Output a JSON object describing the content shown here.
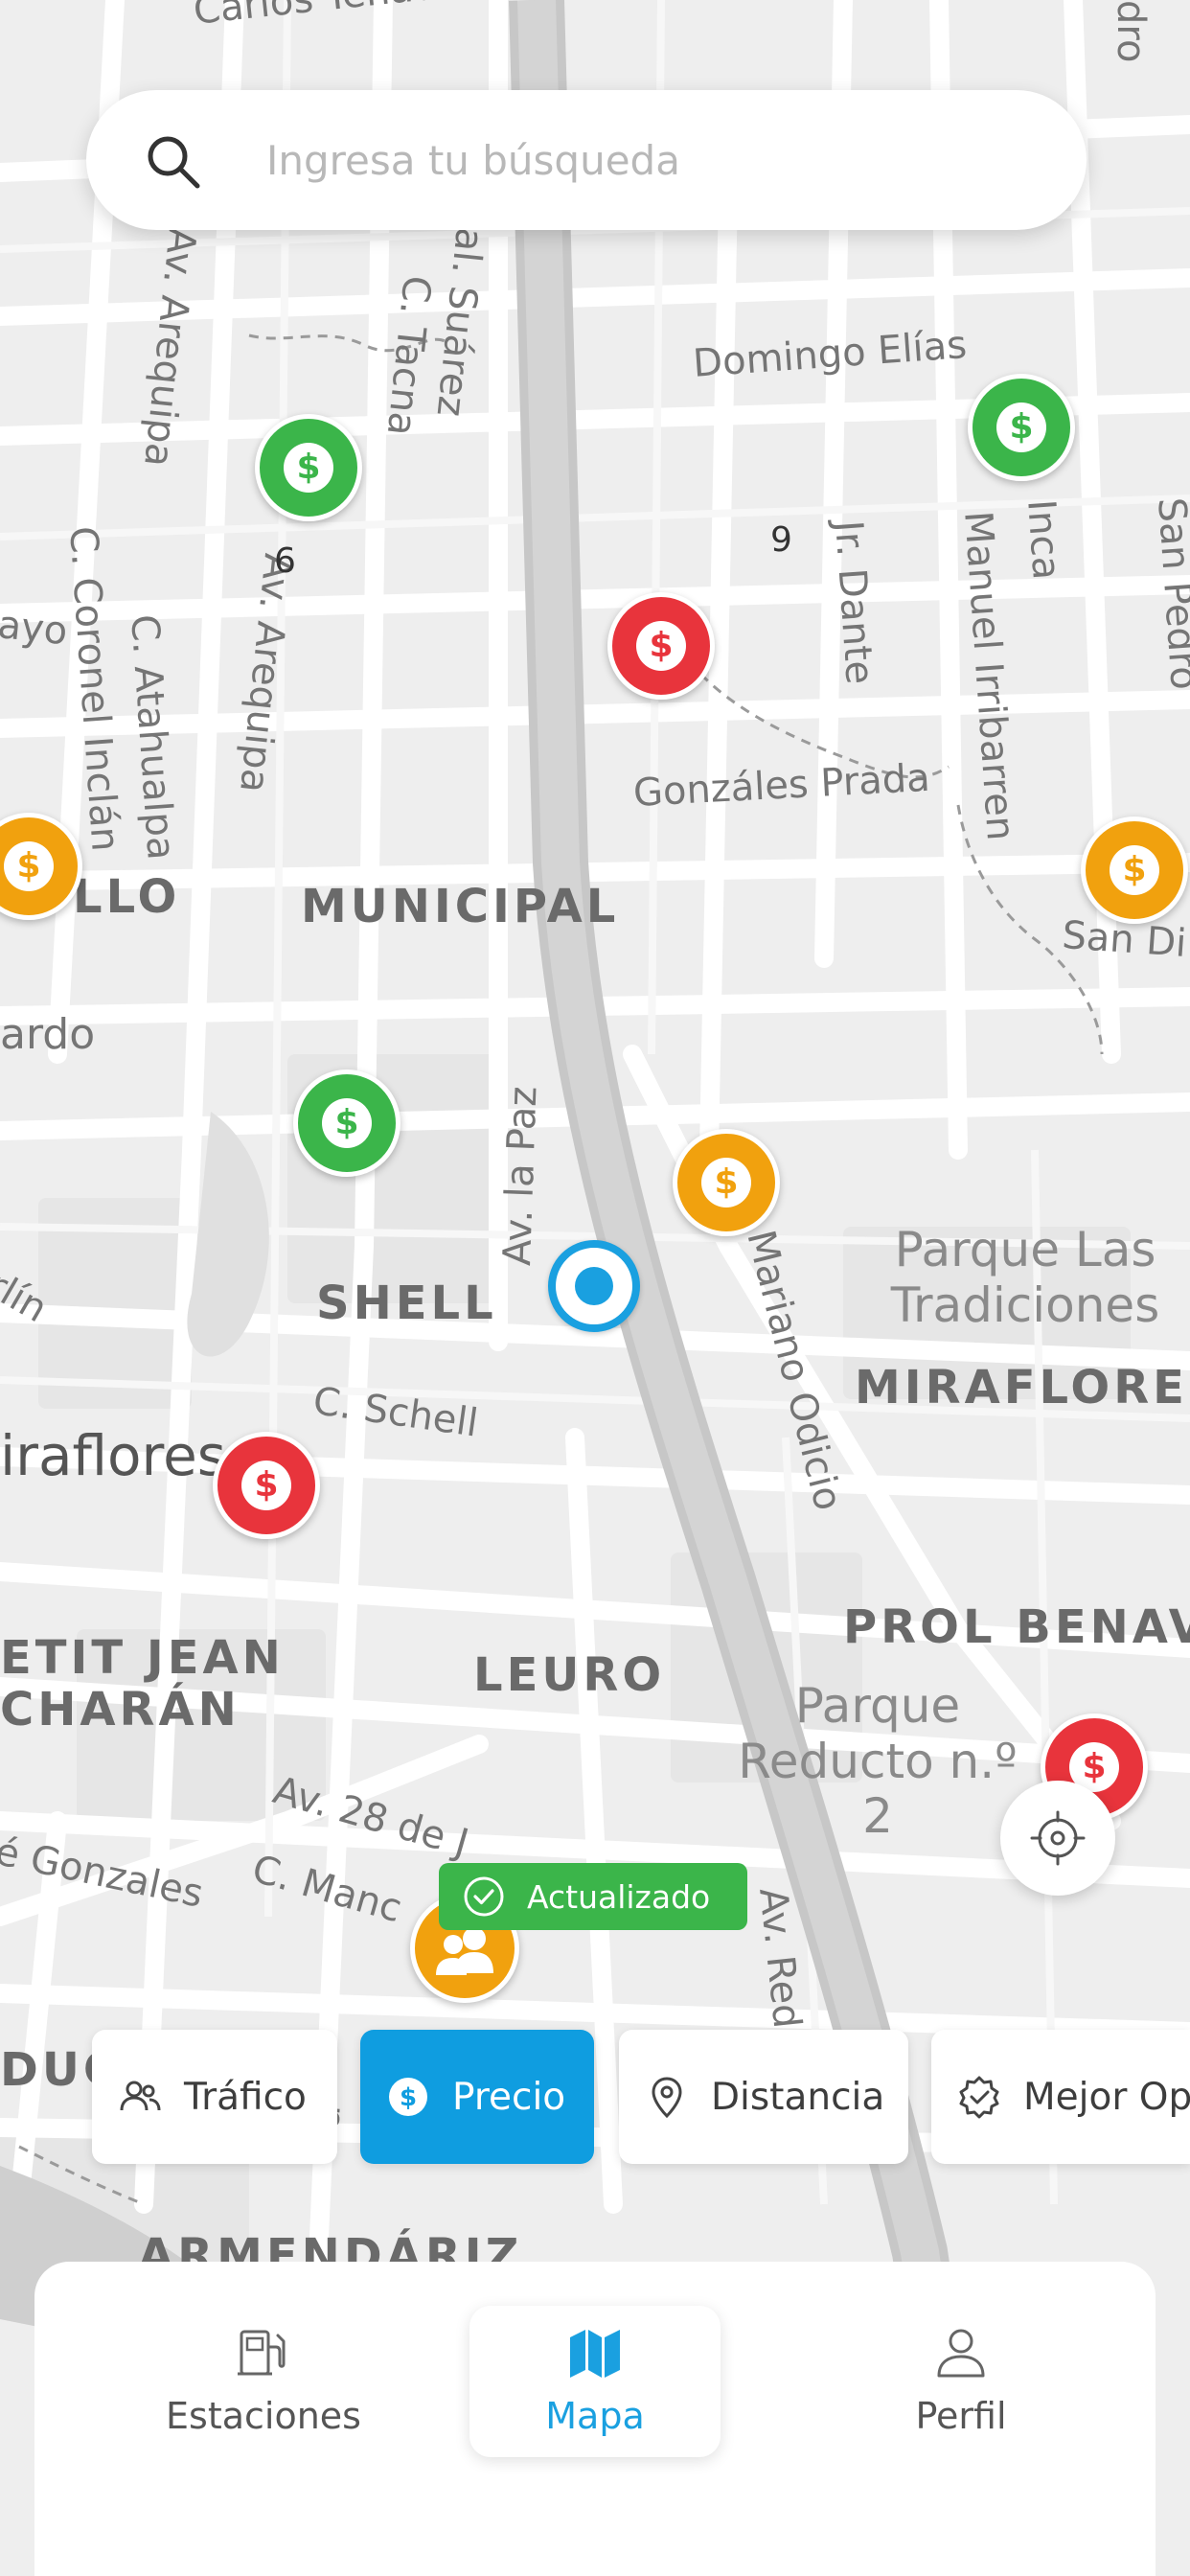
{
  "search": {
    "placeholder": "Ingresa tu búsqueda",
    "icon": "search-icon"
  },
  "map": {
    "street_labels": [
      "Carlos Tenaud",
      "Av. Arequipa",
      "Av. Arequipa",
      "C. Tacna",
      "al. Suárez",
      "Domingo Elías",
      "Jr. Dante",
      "Manuel Irribarren",
      "Inca",
      "San Pedro",
      "C. Coronel Inclán",
      "C. Atahualpa",
      "Gonzáles Prada",
      "San Di",
      "Av. la Paz",
      "Mariano Odicio",
      "C. Schell",
      "Av. 28 de J",
      "C. Manc",
      "é Gonzales",
      "Av. Redu",
      "Da",
      "ardo",
      "ayo",
      "rlín",
      "dro"
    ],
    "district_labels": [
      "MUNICIPAL",
      "LLO",
      "SHELL",
      "MIRAFLORES",
      "PROL BENAV",
      "LEURO",
      "ETIT JEAN",
      "CHARÁN",
      "DUC",
      "ARMENDÁRIZ"
    ],
    "place_labels": [
      "Parque Las Tradiciones",
      "Parque Reducto n.º 2",
      "iraflores"
    ],
    "block_numbers": [
      "6",
      "9"
    ]
  },
  "stations": [
    {
      "status": "green",
      "symbol": "$"
    },
    {
      "status": "green",
      "symbol": "$"
    },
    {
      "status": "red",
      "symbol": "$"
    },
    {
      "status": "orange",
      "symbol": "$"
    },
    {
      "status": "orange",
      "symbol": "$"
    },
    {
      "status": "green",
      "symbol": "$"
    },
    {
      "status": "orange",
      "symbol": "$"
    },
    {
      "status": "red",
      "symbol": "$"
    },
    {
      "status": "red",
      "symbol": "$"
    }
  ],
  "status_badge": {
    "label": "Actualizado",
    "icon": "check-circle-icon"
  },
  "filters": [
    {
      "label": "Tráfico",
      "icon": "users-icon",
      "active": false
    },
    {
      "label": "Precio",
      "icon": "dollar-circle-icon",
      "active": true
    },
    {
      "label": "Distancia",
      "icon": "map-pin-icon",
      "active": false
    },
    {
      "label": "Mejor Op",
      "icon": "badge-check-icon",
      "active": false
    }
  ],
  "bottom_nav": [
    {
      "label": "Estaciones",
      "icon": "fuel-pump-icon",
      "active": false
    },
    {
      "label": "Mapa",
      "icon": "map-icon",
      "active": true
    },
    {
      "label": "Perfil",
      "icon": "user-icon",
      "active": false
    }
  ],
  "colors": {
    "primary": "#1aa0e0",
    "active_chip": "#0f9de0",
    "green": "#3bb54a",
    "red": "#e8343c",
    "orange": "#f1a10e",
    "map_bg": "#f0f0f0"
  }
}
